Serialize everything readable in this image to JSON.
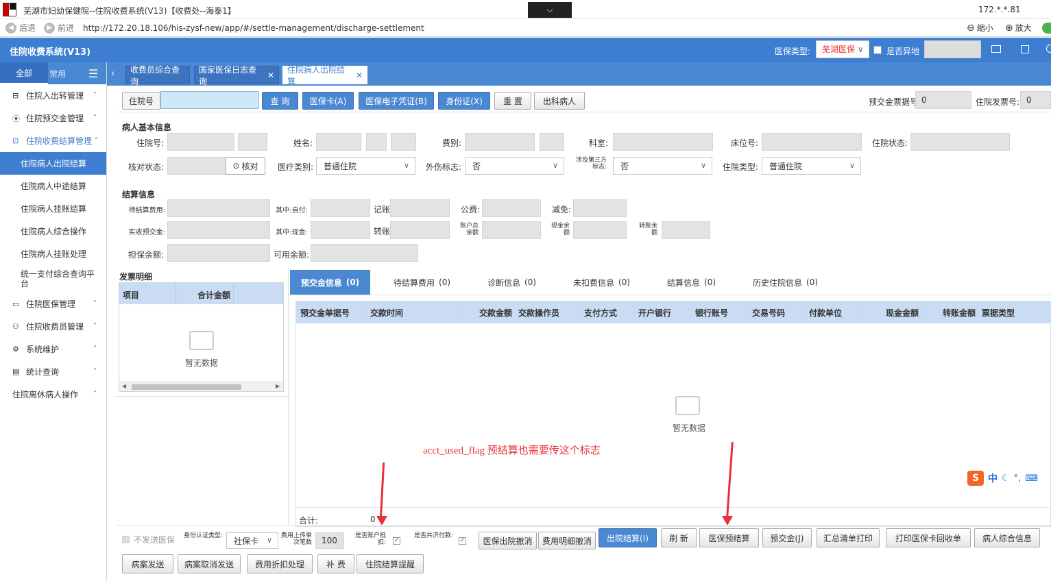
{
  "window": {
    "title": "芜湖市妇幼保健院--住院收费系统(V13)【收费处--海泰1】",
    "ip": "172.*.*.81"
  },
  "browser": {
    "back_label": "后退",
    "forward_label": "前进",
    "url": "http://172.20.18.106/his-zysf-new/app/#/settle-management/discharge-settlement",
    "zoom_out_label": "缩小",
    "zoom_in_label": "放大"
  },
  "app": {
    "title": "住院收费系统(V13)",
    "insurance_type_label": "医保类型:",
    "insurance_type_value": "芜湖医保",
    "other_place_label": "是否异地"
  },
  "sidebar": {
    "tab_all": "全部",
    "tab_common": "常用",
    "items": [
      {
        "label": "住院入出转管理"
      },
      {
        "label": "住院预交金管理"
      },
      {
        "label": "住院收费结算管理"
      }
    ],
    "sub_items": [
      {
        "label": "住院病人出院结算"
      },
      {
        "label": "住院病人中途结算"
      },
      {
        "label": "住院病人挂账结算"
      },
      {
        "label": "住院病人综合操作"
      },
      {
        "label": "住院病人挂账处理"
      },
      {
        "label": "统一支付综合查询平台"
      }
    ],
    "items2": [
      {
        "label": "住院医保管理"
      },
      {
        "label": "住院收费员管理"
      },
      {
        "label": "系统维护"
      },
      {
        "label": "统计查询"
      },
      {
        "label": "住院离休病人操作"
      }
    ]
  },
  "page_tabs": [
    {
      "label": "收费员综合查询"
    },
    {
      "label": "国家医保日志查询"
    },
    {
      "label": "住院病人出院结算"
    }
  ],
  "toolbar": {
    "admission_no_label": "住院号",
    "query": "查 询",
    "insurance_card": "医保卡(A)",
    "e_voucher": "医保电子凭证(B)",
    "id_card": "身份证(X)",
    "reset": "重 置",
    "discharged": "出科病人",
    "prepay_receipt_label": "预交金票据号:",
    "prepay_receipt_value": "0",
    "invoice_no_label": "住院发票号:",
    "invoice_no_value": "0"
  },
  "patient": {
    "section": "病人基本信息",
    "admission_no": "住院号:",
    "name": "姓名:",
    "fee_type": "费别:",
    "dept": "科室:",
    "bed_no": "床位号:",
    "status": "住院状态:",
    "verify_status": "核对状态:",
    "verify_btn": "核对",
    "med_category": "医疗类别:",
    "med_category_value": "普通住院",
    "injury": "外伤标志:",
    "injury_value": "否",
    "third_party": "涉及第三方标志:",
    "third_party_value": "否",
    "inpatient_type": "住院类型:",
    "inpatient_type_value": "普通住院"
  },
  "settle": {
    "section": "结算信息",
    "pending_fee": "待结算费用:",
    "self_pay": "其中:自付:",
    "account": "记账",
    "public_fee": "公费:",
    "reduction": "减免:",
    "received_prepay": "实收预交金:",
    "cash": "其中:现金:",
    "transfer": "转账",
    "account_total": "账户总余额",
    "cash_balance": "现金余额",
    "transfer_balance": "转账余额",
    "guarantee_balance": "担保余额:",
    "available_balance": "可用余额:"
  },
  "invoice": {
    "section": "发票明细",
    "col_item": "项目",
    "col_total": "合计金额",
    "empty": "暂无数据"
  },
  "bottom_tabs": [
    {
      "label": "预交金信息",
      "count": "(0)"
    },
    {
      "label": "待结算费用",
      "count": "(0)"
    },
    {
      "label": "诊断信息",
      "count": "(0)"
    },
    {
      "label": "未扣费信息",
      "count": "(0)"
    },
    {
      "label": "结算信息",
      "count": "(0)"
    },
    {
      "label": "历史住院信息",
      "count": "(0)"
    }
  ],
  "table": {
    "columns": [
      "预交金单据号",
      "交款时间",
      "交款金额",
      "交款操作员",
      "支付方式",
      "开户银行",
      "银行账号",
      "交易号码",
      "付款单位",
      "现金金额",
      "转账金额",
      "票据类型"
    ],
    "empty": "暂无数据",
    "total_label": "合计:",
    "total_value": "0"
  },
  "annotation": {
    "text": "acct_used_flag 预结算也需要传这个标志"
  },
  "footer": {
    "no_send_insurance": "不发送医保",
    "id_auth_type": "身份认证类型:",
    "id_auth_value": "社保卡",
    "upload_count_label": "费用上传单次笔数",
    "upload_count_value": "100",
    "acct_deduct": "是否账户抵扣:",
    "mutual_aid": "是否共济付款:",
    "cancel_discharge": "医保出院撤消",
    "cancel_detail": "费用明细撤消",
    "discharge_settle": "出院结算(I)",
    "refresh": "刷 新",
    "pre_settle": "医保预结算",
    "prepay": "预交金(J)",
    "print_summary": "汇总清单打印",
    "print_receipt": "打印医保卡回收单",
    "patient_info": "病人综合信息",
    "send_record": "病案发送",
    "cancel_record": "病案取消发送",
    "discount": "费用折扣处理",
    "supplement": "补 费",
    "reminder": "住院结算提醒"
  },
  "ime": {
    "lang": "中"
  }
}
